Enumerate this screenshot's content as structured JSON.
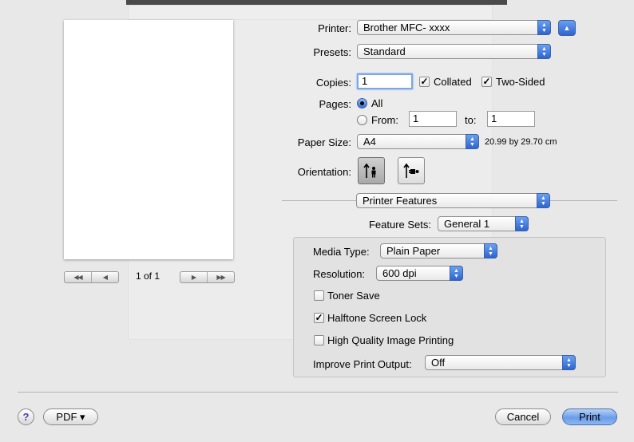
{
  "printer": {
    "label": "Printer:",
    "value": "Brother MFC- xxxx"
  },
  "presets": {
    "label": "Presets:",
    "value": "Standard"
  },
  "copies": {
    "label": "Copies:",
    "value": "1",
    "collated": {
      "label": "Collated",
      "checked": true
    },
    "two_sided": {
      "label": "Two-Sided",
      "checked": true
    }
  },
  "pages": {
    "label": "Pages:",
    "all_label": "All",
    "from_label": "From:",
    "from_value": "1",
    "to_label": "to:",
    "to_value": "1",
    "selected": "All"
  },
  "paper_size": {
    "label": "Paper Size:",
    "value": "A4",
    "dimensions": "20.99 by 29.70 cm"
  },
  "orientation": {
    "label": "Orientation:",
    "selected": "portrait"
  },
  "section_popup": {
    "value": "Printer Features"
  },
  "feature_sets": {
    "label": "Feature Sets:",
    "value": "General 1"
  },
  "media_type": {
    "label": "Media Type:",
    "value": "Plain Paper"
  },
  "resolution": {
    "label": "Resolution:",
    "value": "600 dpi"
  },
  "toner_save": {
    "label": "Toner Save",
    "checked": false
  },
  "halftone_lock": {
    "label": "Halftone Screen Lock",
    "checked": true
  },
  "high_quality": {
    "label": "High Quality Image Printing",
    "checked": false
  },
  "improve_output": {
    "label": "Improve Print Output:",
    "value": "Off"
  },
  "preview": {
    "page_indicator": "1 of 1"
  },
  "footer": {
    "help": "?",
    "pdf_label": "PDF ▾",
    "cancel_label": "Cancel",
    "print_label": "Print"
  },
  "icons": [
    "chevron-up-icon",
    "help-icon",
    "portrait-icon",
    "landscape-icon",
    "first-page-icon",
    "prev-page-icon",
    "next-page-icon",
    "last-page-icon"
  ]
}
